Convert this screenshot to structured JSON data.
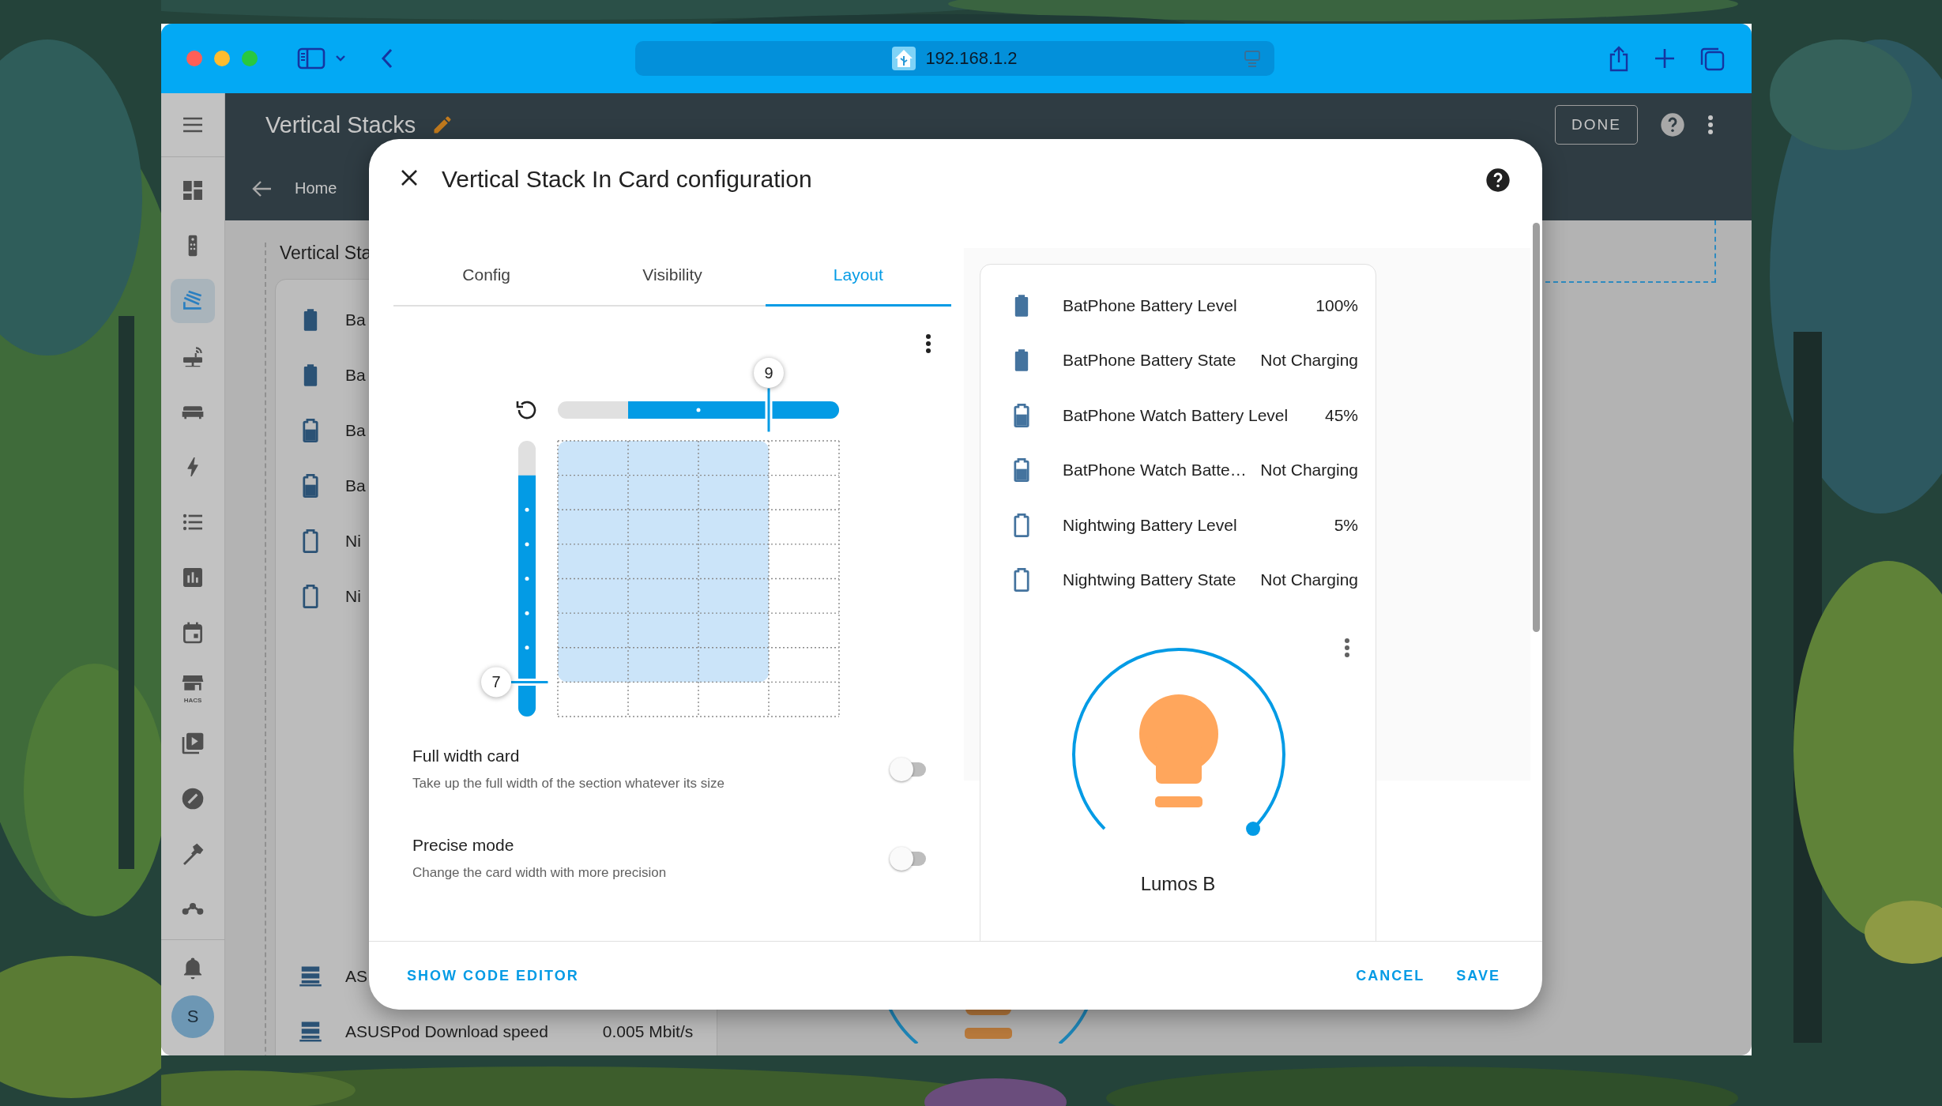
{
  "browser": {
    "address": "192.168.1.2"
  },
  "dashboard": {
    "title": "Vertical Stacks",
    "done_button": "DONE",
    "breadcrumb": "Home",
    "sidebar": {
      "items": [
        {
          "kind": "dashboard",
          "selected": false
        },
        {
          "kind": "remote",
          "selected": false
        },
        {
          "kind": "stack",
          "selected": true
        },
        {
          "kind": "router",
          "selected": false
        },
        {
          "kind": "sofa",
          "selected": false
        },
        {
          "kind": "energy",
          "selected": false
        },
        {
          "kind": "list",
          "selected": false
        },
        {
          "kind": "chart",
          "selected": false
        },
        {
          "kind": "calendar",
          "selected": false
        },
        {
          "kind": "store",
          "selected": false,
          "label": "HACS"
        },
        {
          "kind": "media",
          "selected": false
        },
        {
          "kind": "compass",
          "selected": false
        },
        {
          "kind": "hammer",
          "selected": false
        },
        {
          "kind": "network",
          "selected": false
        }
      ],
      "avatar": "S"
    },
    "section_title": "Vertical Sta",
    "rows": [
      {
        "kind": "full",
        "name": "Ba"
      },
      {
        "kind": "full",
        "name": "Ba"
      },
      {
        "kind": "half",
        "name": "Ba"
      },
      {
        "kind": "half",
        "name": "Ba"
      },
      {
        "kind": "empty",
        "name": "Ni"
      },
      {
        "kind": "empty",
        "name": "Ni"
      }
    ],
    "bottom_rows": [
      {
        "name": "AS"
      },
      {
        "name": "ASUSPod Download speed",
        "value": "0.005 Mbit/s"
      }
    ]
  },
  "dialog": {
    "title": "Vertical Stack In Card configuration",
    "tabs": [
      {
        "label": "Config",
        "selected": false
      },
      {
        "label": "Visibility",
        "selected": false
      },
      {
        "label": "Layout",
        "selected": true
      }
    ],
    "layout": {
      "width": {
        "value": "9",
        "level": 0.75
      },
      "height": {
        "value": "7",
        "level": 0.875
      },
      "options": [
        {
          "label": "Full width card",
          "description": "Take up the full width of the section whatever its size",
          "on": false
        },
        {
          "label": "Precise mode",
          "description": "Change the card width with more precision",
          "on": false
        }
      ]
    },
    "preview": {
      "entities": [
        {
          "kind": "full",
          "name": "BatPhone Battery Level",
          "state": "100%"
        },
        {
          "kind": "full",
          "name": "BatPhone Battery State",
          "state": "Not Charging"
        },
        {
          "kind": "half",
          "name": "BatPhone Watch Battery Level",
          "state": "45%"
        },
        {
          "kind": "half",
          "name": "BatPhone Watch Batte…",
          "state": "Not Charging"
        },
        {
          "kind": "empty",
          "name": "Nightwing Battery Level",
          "state": "5%"
        },
        {
          "kind": "empty",
          "name": "Nightwing Battery State",
          "state": "Not Charging"
        }
      ],
      "light": {
        "name": "Lumos B"
      }
    },
    "footer": {
      "code_button": "SHOW CODE EDITOR",
      "buttons": [
        "CANCEL",
        "SAVE"
      ]
    }
  }
}
